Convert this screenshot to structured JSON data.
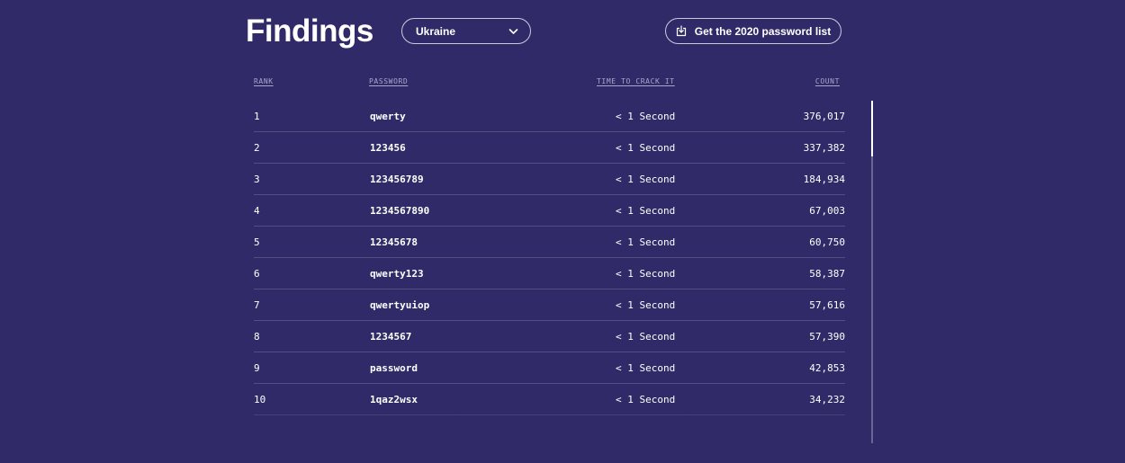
{
  "header": {
    "title": "Findings",
    "country": "Ukraine",
    "download_label": "Get the 2020 password list"
  },
  "icons": {
    "dropdown": "chevron-down-icon",
    "download": "download-icon"
  },
  "table": {
    "columns": {
      "rank": "RANK",
      "password": "PASSWORD",
      "time": "TIME TO CRACK IT",
      "count": "COUNT"
    },
    "rows": [
      {
        "rank": "1",
        "password": "qwerty",
        "time": "< 1 Second",
        "count": "376,017"
      },
      {
        "rank": "2",
        "password": "123456",
        "time": "< 1 Second",
        "count": "337,382"
      },
      {
        "rank": "3",
        "password": "123456789",
        "time": "< 1 Second",
        "count": "184,934"
      },
      {
        "rank": "4",
        "password": "1234567890",
        "time": "< 1 Second",
        "count": "67,003"
      },
      {
        "rank": "5",
        "password": "12345678",
        "time": "< 1 Second",
        "count": "60,750"
      },
      {
        "rank": "6",
        "password": "qwerty123",
        "time": "< 1 Second",
        "count": "58,387"
      },
      {
        "rank": "7",
        "password": "qwertyuiop",
        "time": "< 1 Second",
        "count": "57,616"
      },
      {
        "rank": "8",
        "password": "1234567",
        "time": "< 1 Second",
        "count": "57,390"
      },
      {
        "rank": "9",
        "password": "password",
        "time": "< 1 Second",
        "count": "42,853"
      },
      {
        "rank": "10",
        "password": "1qaz2wsx",
        "time": "< 1 Second",
        "count": "34,232"
      }
    ]
  },
  "colors": {
    "background": "#302b68",
    "text": "#ffffff",
    "muted": "#a9a6cc"
  }
}
